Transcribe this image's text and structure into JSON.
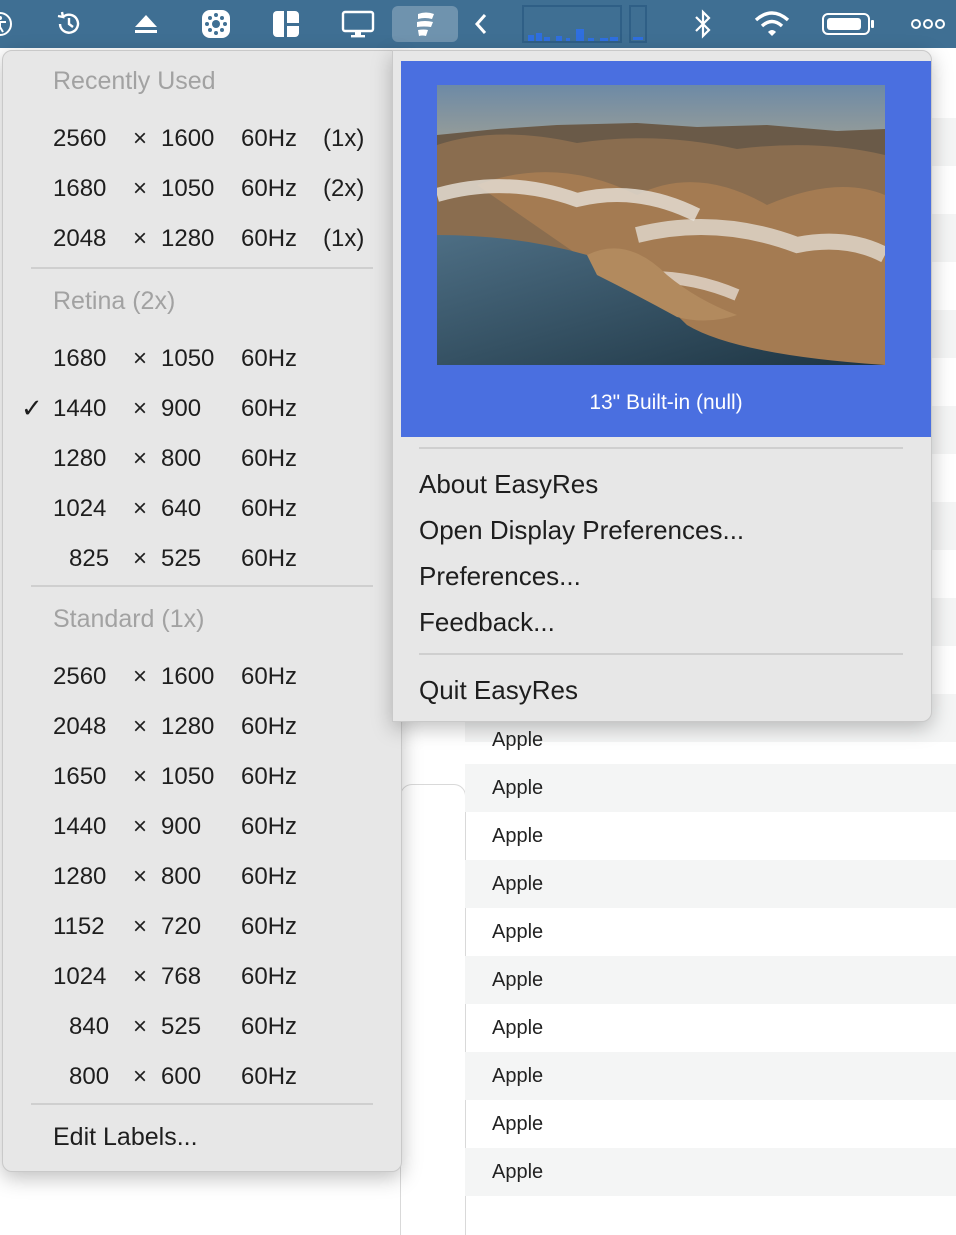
{
  "menubar": {
    "icons": [
      "accessibility-icon",
      "time-machine-icon",
      "eject-icon",
      "control-center-icon",
      "window-layout-icon",
      "display-icon",
      "easyres-icon",
      "chevron-left-icon",
      "activity-graph-icon",
      "bluetooth-icon",
      "wifi-icon",
      "battery-icon",
      "more-icon"
    ],
    "active_icon": "easyres-icon",
    "background": "#3f6f93"
  },
  "resolution_menu": {
    "sections": [
      {
        "title": "Recently Used",
        "items": [
          {
            "w": "2560",
            "x": "×",
            "h": "1600",
            "hz": "60Hz",
            "scale": "(1x)",
            "checked": false
          },
          {
            "w": "1680",
            "x": "×",
            "h": "1050",
            "hz": "60Hz",
            "scale": "(2x)",
            "checked": false
          },
          {
            "w": "2048",
            "x": "×",
            "h": "1280",
            "hz": "60Hz",
            "scale": "(1x)",
            "checked": false
          }
        ]
      },
      {
        "title": "Retina (2x)",
        "items": [
          {
            "w": "1680",
            "x": "×",
            "h": "1050",
            "hz": "60Hz",
            "checked": false
          },
          {
            "w": "1440",
            "x": "×",
            "h": "900",
            "hz": "60Hz",
            "checked": true
          },
          {
            "w": "1280",
            "x": "×",
            "h": "800",
            "hz": "60Hz",
            "checked": false
          },
          {
            "w": "1024",
            "x": "×",
            "h": "640",
            "hz": "60Hz",
            "checked": false
          },
          {
            "w": "825",
            "x": "×",
            "h": "525",
            "hz": "60Hz",
            "checked": false
          }
        ]
      },
      {
        "title": "Standard (1x)",
        "items": [
          {
            "w": "2560",
            "x": "×",
            "h": "1600",
            "hz": "60Hz",
            "checked": false
          },
          {
            "w": "2048",
            "x": "×",
            "h": "1280",
            "hz": "60Hz",
            "checked": false
          },
          {
            "w": "1650",
            "x": "×",
            "h": "1050",
            "hz": "60Hz",
            "checked": false
          },
          {
            "w": "1440",
            "x": "×",
            "h": "900",
            "hz": "60Hz",
            "checked": false
          },
          {
            "w": "1280",
            "x": "×",
            "h": "800",
            "hz": "60Hz",
            "checked": false
          },
          {
            "w": "1152",
            "x": "×",
            "h": "720",
            "hz": "60Hz",
            "checked": false
          },
          {
            "w": "1024",
            "x": "×",
            "h": "768",
            "hz": "60Hz",
            "checked": false
          },
          {
            "w": "840",
            "x": "×",
            "h": "525",
            "hz": "60Hz",
            "checked": false
          },
          {
            "w": "800",
            "x": "×",
            "h": "600",
            "hz": "60Hz",
            "checked": false
          }
        ]
      }
    ],
    "checkmark_glyph": "✓",
    "edit_labels": "Edit Labels..."
  },
  "info_menu": {
    "display_name": "13\" Built-in (null)",
    "accent": "#4a6fe0",
    "items": {
      "about": "About EasyRes",
      "open_display_prefs": "Open Display Preferences...",
      "preferences": "Preferences...",
      "feedback": "Feedback...",
      "quit": "Quit EasyRes"
    }
  },
  "background_list": {
    "rows": [
      "Apple",
      "Apple",
      "Apple",
      "Apple",
      "Apple",
      "Apple",
      "Apple",
      "Apple",
      "Apple",
      "Apple"
    ]
  }
}
